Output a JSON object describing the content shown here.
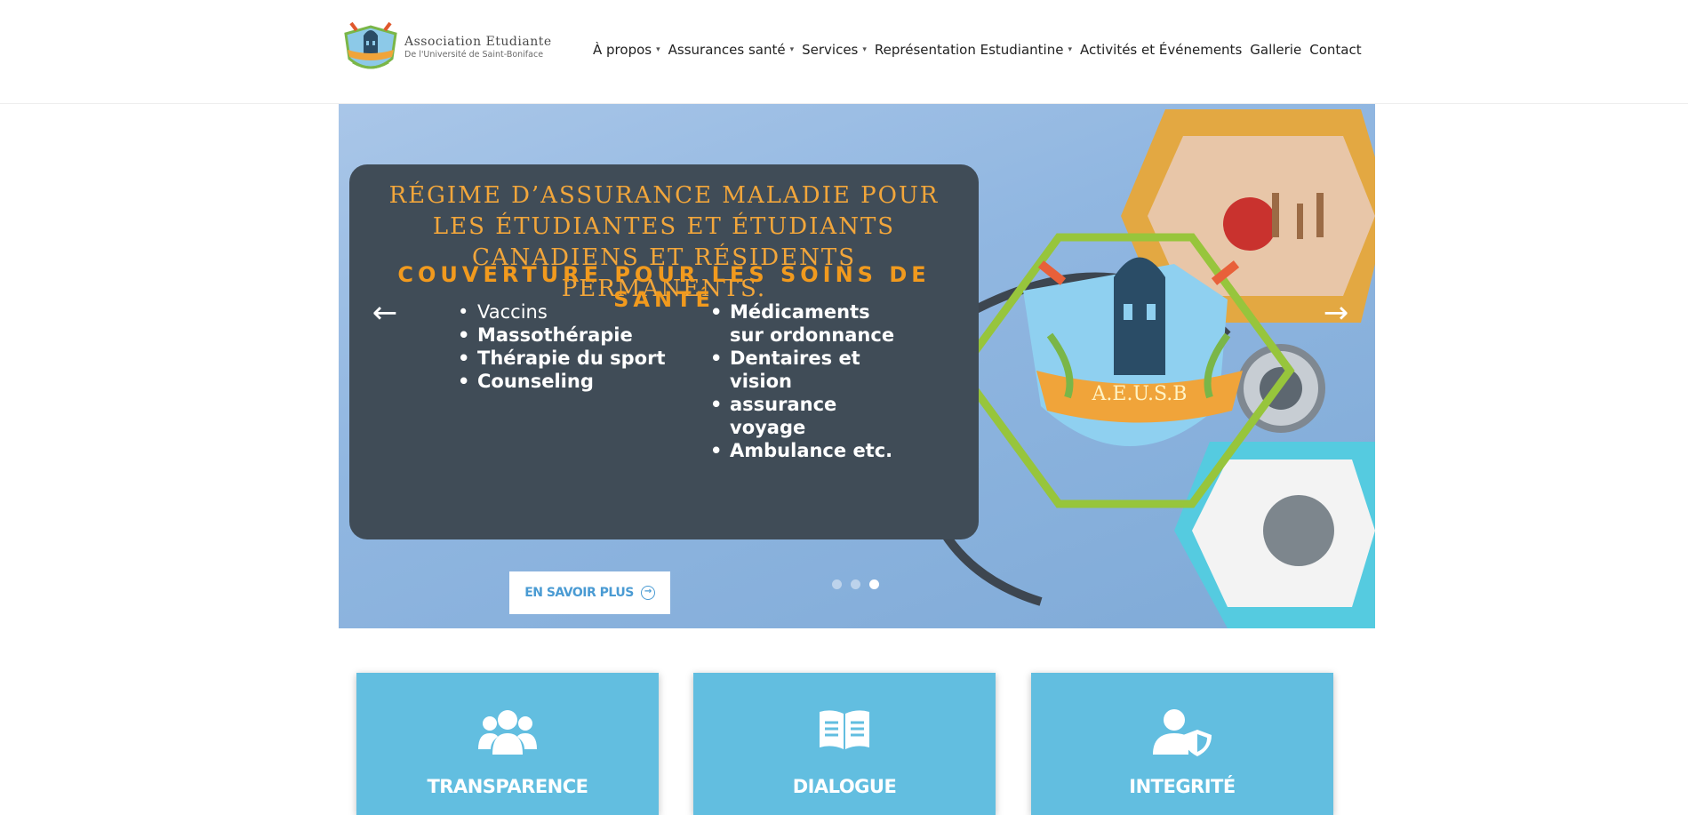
{
  "logo": {
    "title": "Association Etudiante",
    "subtitle": "De l'Université de Saint-Boniface",
    "badge": "A.E.U.S.B"
  },
  "nav": [
    {
      "label": "À propos",
      "has_dropdown": true
    },
    {
      "label": "Assurances santé",
      "has_dropdown": true
    },
    {
      "label": "Services",
      "has_dropdown": true
    },
    {
      "label": "Représentation Estudiantine",
      "has_dropdown": true
    },
    {
      "label": "Activités et Événements",
      "has_dropdown": false
    },
    {
      "label": "Gallerie",
      "has_dropdown": false
    },
    {
      "label": "Contact",
      "has_dropdown": false
    }
  ],
  "icons": {
    "caret": "▾",
    "prev": "←",
    "next": "→",
    "cta": "→"
  },
  "hero": {
    "heading": "RÉGIME D’ASSURANCE MALADIE POUR LES ÉTUDIANTES ET ÉTUDIANTS CANADIENS ET RÉSIDENTS PERMANENTS.",
    "subheading": "COUVERTURE POUR LES SOINS DE SANTÉ",
    "left_items": [
      "Vaccins",
      "Massothérapie",
      "Thérapie du sport",
      "Counseling"
    ],
    "right_items": [
      "Médicaments sur ordonnance",
      "Dentaires et vision",
      "assurance voyage",
      "Ambulance etc."
    ],
    "cta_label": "EN SAVOIR PLUS",
    "slide_count": 3,
    "active_slide": 3
  },
  "cards": [
    {
      "title": "TRANSPARENCE",
      "icon": "users-icon"
    },
    {
      "title": "DIALOGUE",
      "icon": "book-icon"
    },
    {
      "title": "INTEGRITÉ",
      "icon": "user-shield-icon"
    }
  ],
  "colors": {
    "card_bg": "#62bee0",
    "panel_bg": "#404c57",
    "heading_orange": "#f2a63b",
    "cta_text": "#4a9bd3"
  }
}
